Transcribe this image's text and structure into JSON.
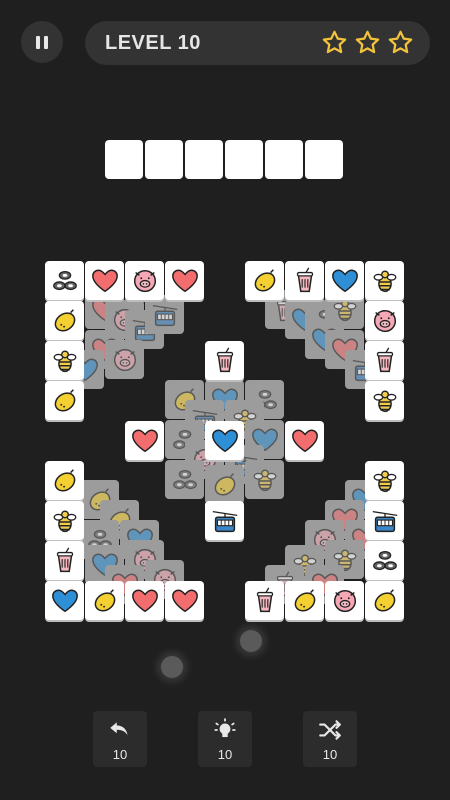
{
  "header": {
    "level_label": "LEVEL 10",
    "stars": 3
  },
  "tray": {
    "slots": 6
  },
  "tiles_top": [
    {
      "icon": "sushi-icon"
    },
    {
      "icon": "heart-icon"
    },
    {
      "icon": "pig-icon"
    },
    {
      "icon": "heart-icon"
    },
    {
      "icon": "lemon-icon"
    },
    {
      "icon": "milkshake-icon"
    },
    {
      "icon": "blue-heart-icon"
    },
    {
      "icon": "bee-icon"
    },
    {
      "icon": "lemon-icon"
    },
    {
      "icon": "bee-icon"
    },
    {
      "icon": "lemon-icon"
    },
    {
      "icon": "pig-icon"
    },
    {
      "icon": "milkshake-icon"
    },
    {
      "icon": "bee-icon"
    },
    {
      "icon": "milkshake-icon"
    },
    {
      "icon": "heart-icon"
    },
    {
      "icon": "blue-heart-icon"
    },
    {
      "icon": "heart-icon"
    },
    {
      "icon": "cable-car-icon"
    },
    {
      "icon": "lemon-icon"
    },
    {
      "icon": "bee-icon"
    },
    {
      "icon": "milkshake-icon"
    },
    {
      "icon": "blue-heart-icon"
    },
    {
      "icon": "lemon-icon"
    },
    {
      "icon": "heart-icon"
    },
    {
      "icon": "heart-icon"
    },
    {
      "icon": "bee-icon"
    },
    {
      "icon": "cable-car-icon"
    },
    {
      "icon": "sushi-icon"
    },
    {
      "icon": "milkshake-icon"
    },
    {
      "icon": "lemon-icon"
    },
    {
      "icon": "pig-icon"
    },
    {
      "icon": "lemon-icon"
    }
  ],
  "controls": [
    {
      "name": "undo",
      "icon": "undo-icon",
      "count": "10"
    },
    {
      "name": "hint",
      "icon": "lightbulb-icon",
      "count": "10"
    },
    {
      "name": "shuffle",
      "icon": "shuffle-icon",
      "count": "10"
    }
  ],
  "colors": {
    "background": "#1f1f1f",
    "heart": "#f26d6d",
    "blue_heart": "#2f8fd6",
    "lemon": "#f5d031",
    "pig": "#f4a7b4",
    "bee": "#f0cc4d"
  }
}
